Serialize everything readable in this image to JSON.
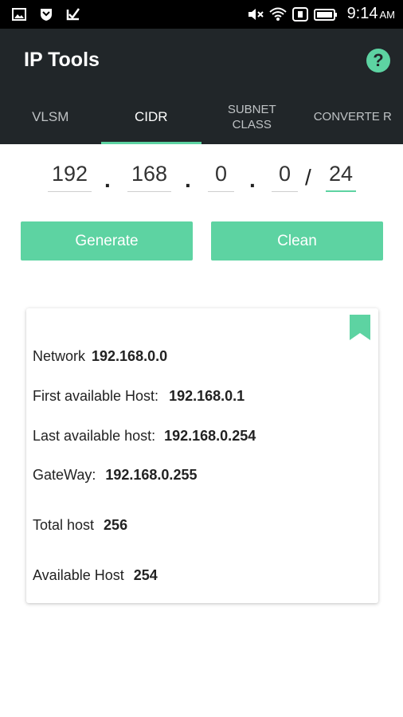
{
  "status_bar": {
    "time": "9:14",
    "ampm": "AM",
    "icons": [
      "gallery-icon",
      "shield-icon",
      "checkmark-app-icon",
      "mute-icon",
      "wifi-icon",
      "notification-icon",
      "battery-icon"
    ]
  },
  "app": {
    "title": "IP Tools",
    "help_label": "?"
  },
  "tabs": [
    {
      "label": "VLSM",
      "active": false
    },
    {
      "label": "CIDR",
      "active": true
    },
    {
      "label": "SUBNET CLASS",
      "active": false
    },
    {
      "label": "CONVERTE R",
      "active": false
    }
  ],
  "ip": {
    "octet1": "192",
    "octet2": "168",
    "octet3": "0",
    "octet4": "0",
    "dot": ".",
    "slash": "/",
    "mask": "24"
  },
  "buttons": {
    "generate": "Generate",
    "clean": "Clean"
  },
  "results": {
    "network_label": "Network",
    "network_value": "192.168.0.0",
    "first_host_label": "First available Host:",
    "first_host_value": "192.168.0.1",
    "last_host_label": "Last available host:",
    "last_host_value": "192.168.0.254",
    "gateway_label": "GateWay:",
    "gateway_value": "192.168.0.255",
    "total_host_label": "Total host",
    "total_host_value": "256",
    "available_host_label": "Available Host",
    "available_host_value": "254"
  },
  "colors": {
    "accent": "#5dd3a2",
    "app_bar": "#212629",
    "status_bar": "#000000"
  }
}
